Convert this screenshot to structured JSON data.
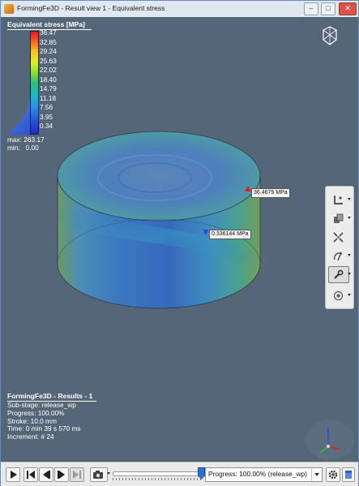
{
  "window": {
    "title": "FormingFe3D - Result view 1 - Equivalent stress",
    "controls": [
      "minimize-icon",
      "maximize-icon",
      "close-icon"
    ]
  },
  "legend": {
    "title": "Equivalent stress [MPa]",
    "ticks": [
      "36.47",
      "32.85",
      "29.24",
      "25.63",
      "22.02",
      "18.40",
      "14.79",
      "11.18",
      "7.56",
      "3.95",
      "0.34"
    ],
    "max_label": "max:",
    "max_value": "263.17",
    "min_label": "min:",
    "min_value": "0.00",
    "colors": {
      "high": "#e4162b",
      "mid": "#2fc07a",
      "low": "#1f2bbb"
    }
  },
  "markers": {
    "max_tag": "36.4679 MPa",
    "min_tag": "0.336144 MPa"
  },
  "results": {
    "title": "FormingFe3D - Results - 1",
    "substage": "Sub-stage: release_wp",
    "progress": "Progress: 100.00%",
    "stroke": "Stroke: 10.0 mm",
    "time": "Time: 0 min 39 s 570 ms",
    "increment": "Increment: # 24"
  },
  "right_toolbar": {
    "tools": [
      "measure-ruler-icon",
      "copy-view-icon",
      "fit-view-icon",
      "section-icon",
      "wrench-settings-icon",
      "camera-orbit-icon"
    ]
  },
  "bottom_toolbar": {
    "buttons": [
      "play-icon",
      "first-frame-icon",
      "previous-frame-icon",
      "next-frame-icon",
      "last-frame-icon",
      "snapshot-icon"
    ],
    "progress_select": "Progress: 100.00% (release_wp)",
    "slider_progress": 1.0,
    "right_icons": [
      "gear-icon",
      "panel-icon"
    ]
  }
}
